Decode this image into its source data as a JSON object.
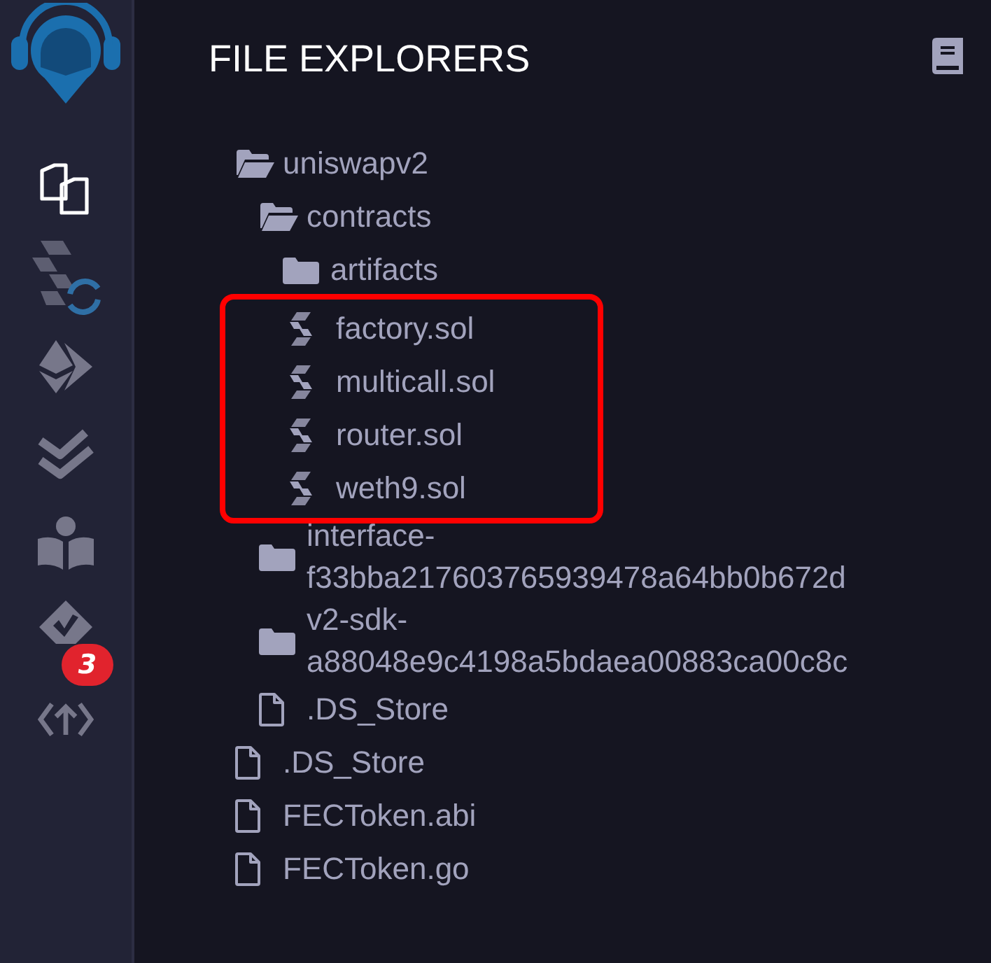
{
  "sidebar": {
    "items": [
      {
        "kind": "logo"
      },
      {
        "kind": "files",
        "selected": true
      },
      {
        "kind": "compiler",
        "selected": false
      },
      {
        "kind": "deploy",
        "selected": false
      },
      {
        "kind": "tests",
        "selected": false
      },
      {
        "kind": "learn",
        "selected": false
      },
      {
        "kind": "checker",
        "selected": false,
        "badge": "3"
      },
      {
        "kind": "remote",
        "selected": false
      }
    ]
  },
  "panel": {
    "title": "FILE EXPLORERS",
    "tree": [
      {
        "name": "uniswapv2",
        "kind": "folder",
        "expanded": true,
        "highlighted": false,
        "children": [
          {
            "name": "contracts",
            "kind": "folder",
            "expanded": true,
            "highlighted": false,
            "children": [
              {
                "name": "artifacts",
                "kind": "folder",
                "expanded": false,
                "highlighted": false
              },
              {
                "name": "factory.sol",
                "kind": "solidity",
                "highlighted": true
              },
              {
                "name": "multicall.sol",
                "kind": "solidity",
                "highlighted": true
              },
              {
                "name": "router.sol",
                "kind": "solidity",
                "highlighted": true
              },
              {
                "name": "weth9.sol",
                "kind": "solidity",
                "highlighted": true
              }
            ]
          },
          {
            "name": "interface-f33bba217603765939478a64bb0b672d",
            "kind": "folder",
            "expanded": false,
            "highlighted": false
          },
          {
            "name": "v2-sdk-a88048e9c4198a5bdaea00883ca00c8c",
            "kind": "folder",
            "expanded": false,
            "highlighted": false
          },
          {
            "name": ".DS_Store",
            "kind": "file",
            "highlighted": false
          }
        ]
      },
      {
        "name": ".DS_Store",
        "kind": "file",
        "highlighted": false
      },
      {
        "name": "FECToken.abi",
        "kind": "file",
        "highlighted": false
      },
      {
        "name": "FECToken.go",
        "kind": "file",
        "highlighted": false
      }
    ]
  }
}
